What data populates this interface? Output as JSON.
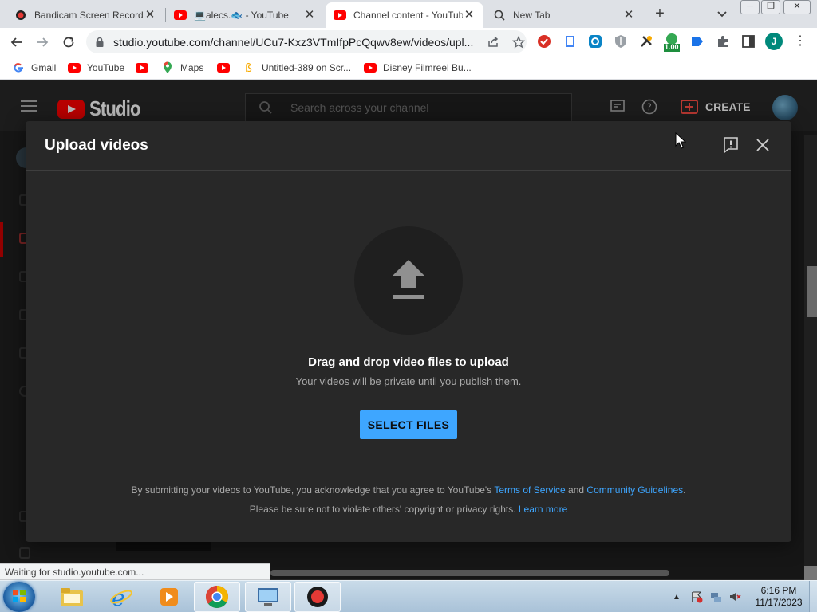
{
  "browser": {
    "tabs": [
      {
        "title": "Bandicam Screen Recorde",
        "icon": "bandicam-icon"
      },
      {
        "title": "💻alecs.🐟 - YouTube",
        "icon": "youtube-icon"
      },
      {
        "title": "Channel content - YouTub",
        "icon": "youtube-icon",
        "active": true
      },
      {
        "title": "New Tab",
        "icon": "search-icon"
      }
    ],
    "url": "studio.youtube.com/channel/UCu7-Kxz3VTmIfpPcQqwv8ew/videos/upl...",
    "extension_badge": "1.00",
    "profile_initial": "J",
    "bookmarks": [
      {
        "label": "Gmail",
        "icon": "google-icon"
      },
      {
        "label": "YouTube",
        "icon": "youtube-icon"
      },
      {
        "label": "",
        "icon": "youtube-icon"
      },
      {
        "label": "Maps",
        "icon": "maps-icon"
      },
      {
        "label": "",
        "icon": "youtube-icon"
      },
      {
        "label": "Untitled-389 on Scr...",
        "icon": "bookmark-icon"
      },
      {
        "label": "Disney Filmreel Bu...",
        "icon": "youtube-icon"
      }
    ],
    "status_text": "Waiting for studio.youtube.com..."
  },
  "studio": {
    "logo_text": "Studio",
    "search_placeholder": "Search across your channel",
    "create_label": "CREATE"
  },
  "dialog": {
    "title": "Upload videos",
    "drag_title": "Drag and drop video files to upload",
    "drag_subtitle": "Your videos will be private until you publish them.",
    "select_button": "SELECT FILES",
    "legal_line1_prefix": "By submitting your videos to YouTube, you acknowledge that you agree to YouTube's ",
    "terms_link": "Terms of Service",
    "legal_and": " and ",
    "guidelines_link": "Community Guidelines",
    "legal_line1_suffix": ".",
    "legal_line2_prefix": "Please be sure not to violate others' copyright or privacy rights. ",
    "learn_more_link": "Learn more"
  },
  "taskbar": {
    "time": "6:16 PM",
    "date": "11/17/2023"
  },
  "colors": {
    "accent_blue": "#3ea6ff",
    "youtube_red": "#ff0000",
    "dialog_bg": "#282828"
  }
}
